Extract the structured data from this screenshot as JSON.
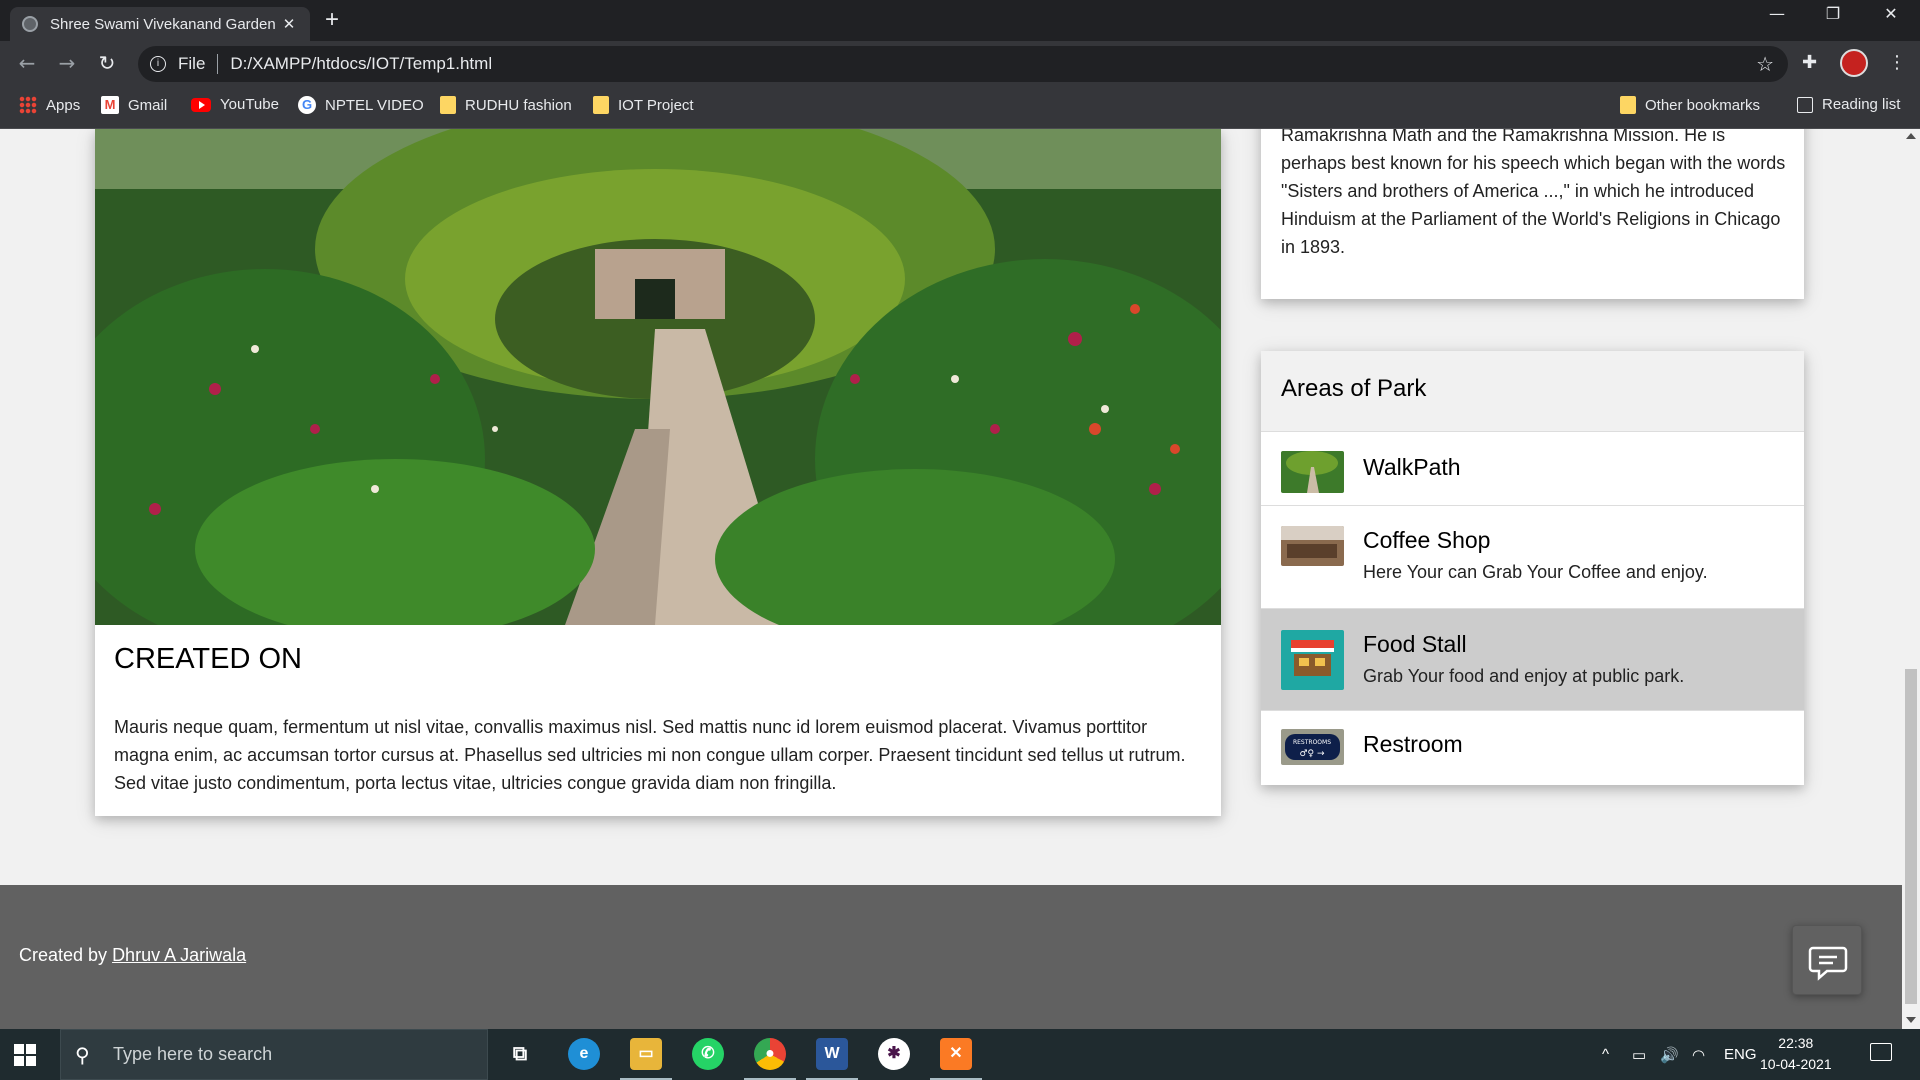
{
  "browser": {
    "tab_title": "Shree Swami Vivekanand Garden",
    "tab_close": "✕",
    "new_tab": "+",
    "url_scheme": "File",
    "url": "D:/XAMPP/htdocs/IOT/Temp1.html",
    "window_controls": {
      "minimize": "—",
      "restore": "❐",
      "close": "✕"
    }
  },
  "bookmarks": {
    "items": [
      "Apps",
      "Gmail",
      "YouTube",
      "NPTEL VIDEO",
      "RUDHU fashion",
      "IOT Project"
    ],
    "other": "Other bookmarks",
    "reading_list": "Reading list"
  },
  "main": {
    "heading": "CREATED ON",
    "body": "Mauris neque quam, fermentum ut nisl vitae, convallis maximus nisl. Sed mattis nunc id lorem euismod placerat. Vivamus porttitor magna enim, ac accumsan tortor cursus at. Phasellus sed ultricies mi non congue ullam corper. Praesent tincidunt sed tellus ut rutrum. Sed vitae justo condimentum, porta lectus vitae, ultricies congue gravida diam non fringilla."
  },
  "about": {
    "text": "nationalism in colonial India. Vivekananda founded the Ramakrishna Math and the Ramakrishna Mission. He is perhaps best known for his speech which began with the words \"Sisters and brothers of America ...,\" in which he introduced Hinduism at the Parliament of the World's Religions in Chicago in 1893."
  },
  "areas": {
    "title": "Areas of Park",
    "items": [
      {
        "name": "WalkPath",
        "desc": ""
      },
      {
        "name": "Coffee Shop",
        "desc": "Here Your can Grab Your Coffee and enjoy."
      },
      {
        "name": "Food Stall",
        "desc": "Grab Your food and enjoy at public park."
      },
      {
        "name": "Restroom",
        "desc": ""
      }
    ],
    "restroom_sign": "RESTROOMS"
  },
  "footer": {
    "prefix": "Created by ",
    "author": "Dhruv A Jariwala"
  },
  "taskbar": {
    "search_placeholder": "Type here to search",
    "language": "ENG",
    "time": "22:38",
    "date": "10-04-2021"
  },
  "colors": {
    "footer_bg": "#616161",
    "highlight_row": "#cccccc",
    "chrome_dark": "#202124",
    "chrome_toolbar": "#35363a"
  }
}
